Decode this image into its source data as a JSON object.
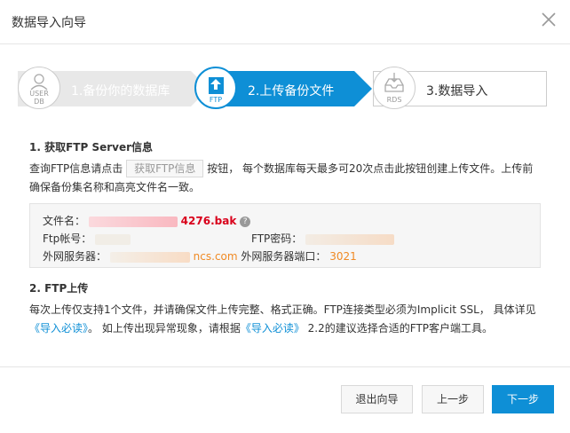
{
  "dialog": {
    "title": "数据导入向导"
  },
  "steps": [
    {
      "label": "1.备份你的数据库",
      "icon": "user-db-icon",
      "icon_text": [
        "USER",
        "DB"
      ]
    },
    {
      "label": "2.上传备份文件",
      "icon": "ftp-upload-icon",
      "icon_text": "FTP"
    },
    {
      "label": "3.数据导入",
      "icon": "rds-icon",
      "icon_text": "RDS"
    }
  ],
  "section1": {
    "title": "1. 获取FTP Server信息",
    "text_before": "查询FTP信息请点击",
    "button": "获取FTP信息",
    "text_after": "按钮， 每个数据库每天最多可20次点击此按钮创建上传文件。上传前",
    "text_line2": "确保备份集名称和高亮文件名一致。"
  },
  "info": {
    "file_label": "文件名：",
    "file_value": "4276.bak",
    "ftp_account_label": "Ftp帐号：",
    "ftp_password_label": "FTP密码：",
    "server_label": "外网服务器：",
    "server_value": "ncs.com",
    "port_label": "外网服务器端口：",
    "port_value": "3021",
    "help_icon": "question-icon"
  },
  "section2": {
    "title": "2. FTP上传",
    "line1_a": "每次上传仅支持1个文件，并请确保文件上传完整、格式正确。FTP连接类型必须为Implicit SSL， 具体详见",
    "link1": "《导入必读》",
    "line2_a": "。 如上传出现异常现象，请根据",
    "link2": "《导入必读》",
    "line2_b": " 2.2的建议选择合适的FTP客户端工具。"
  },
  "footer": {
    "exit": "退出向导",
    "prev": "上一步",
    "next": "下一步"
  },
  "colors": {
    "accent": "#0e8fd6",
    "highlight": "#d9001b",
    "value": "#f08a24"
  }
}
